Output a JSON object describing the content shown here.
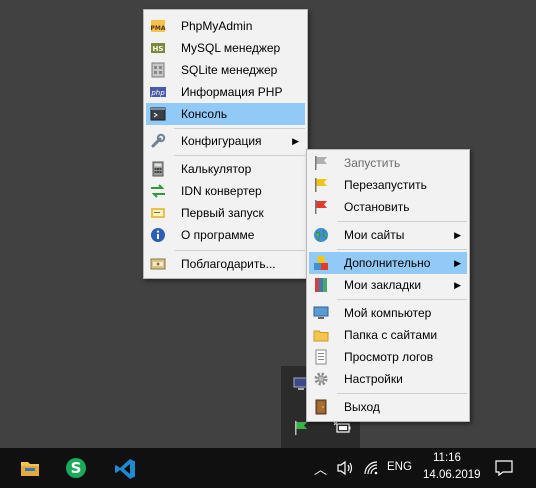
{
  "menu_main": {
    "items": [
      {
        "label": "PhpMyAdmin",
        "icon": "phpmyadmin-icon"
      },
      {
        "label": "MySQL менеджер",
        "icon": "heidisql-icon"
      },
      {
        "label": "SQLite менеджер",
        "icon": "sqlite-icon"
      },
      {
        "label": "Информация PHP",
        "icon": "php-icon"
      },
      {
        "label": "Консоль",
        "icon": "console-icon"
      },
      {
        "label": "Конфигурация",
        "icon": "wrench-icon"
      },
      {
        "label": "Калькулятор",
        "icon": "calculator-icon"
      },
      {
        "label": "IDN конвертер",
        "icon": "idn-converter-icon"
      },
      {
        "label": "Первый запуск",
        "icon": "first-run-icon"
      },
      {
        "label": "О программе",
        "icon": "info-icon"
      },
      {
        "label": "Поблагодарить...",
        "icon": "donate-icon"
      }
    ]
  },
  "menu_tray": {
    "items": [
      {
        "label": "Запустить",
        "icon": "flag-gray-icon"
      },
      {
        "label": "Перезапустить",
        "icon": "flag-yellow-icon"
      },
      {
        "label": "Остановить",
        "icon": "flag-red-icon"
      },
      {
        "label": "Мои сайты",
        "icon": "globe-icon"
      },
      {
        "label": "Дополнительно",
        "icon": "blocks-icon"
      },
      {
        "label": "Мои закладки",
        "icon": "bookmarks-icon"
      },
      {
        "label": "Мой компьютер",
        "icon": "computer-icon"
      },
      {
        "label": "Папка с сайтами",
        "icon": "folder-icon"
      },
      {
        "label": "Просмотр логов",
        "icon": "log-icon"
      },
      {
        "label": "Настройки",
        "icon": "gear-icon"
      },
      {
        "label": "Выход",
        "icon": "exit-door-icon"
      }
    ]
  },
  "taskbar": {
    "apps": [
      "file-explorer-icon",
      "skype-icon",
      "vscode-icon"
    ],
    "language": "ENG",
    "time": "11:16",
    "date": "14.06.2019"
  },
  "colors": {
    "menu_bg": "#f2f2f2",
    "highlight": "#91c9f7",
    "taskbar_bg": "#101010",
    "desktop_bg": "#414141"
  }
}
